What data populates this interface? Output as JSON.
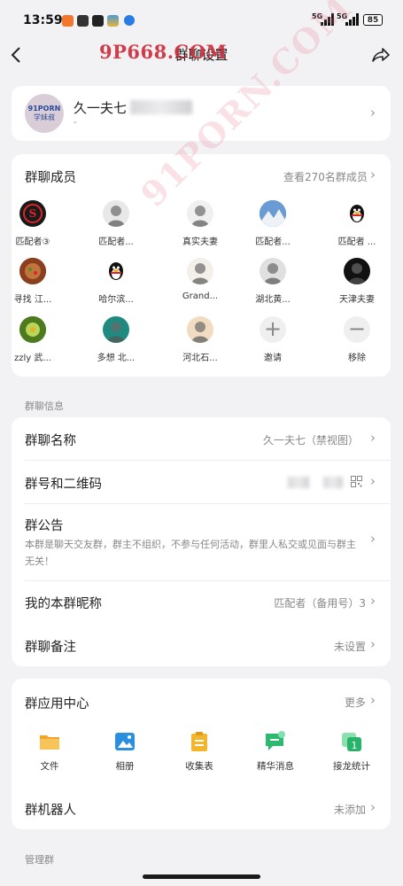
{
  "status": {
    "time": "13:59",
    "net1": "5G",
    "net2": "5G",
    "battery": "85"
  },
  "nav": {
    "title": "群聊设置",
    "watermark": "9P668.COM"
  },
  "diag_watermark": "91PORN.COM",
  "group": {
    "name": "久一夫七",
    "sub": "-",
    "avatar_text1": "91PORN",
    "avatar_text2": "学妹叔"
  },
  "members": {
    "title": "群聊成员",
    "view_all": "查看270名群成员",
    "rows": [
      [
        {
          "name": "匹配者③",
          "color": "#1a1a1a",
          "icon": "S"
        },
        {
          "name": "匹配者...",
          "color": "#e8e8e8",
          "icon": "person"
        },
        {
          "name": "真实夫妻",
          "color": "#f0f0f0",
          "icon": "person"
        },
        {
          "name": "匹配者...",
          "color": "#4a78b0",
          "icon": "mountain"
        },
        {
          "name": "匹配者 ...",
          "color": "#ffffff",
          "icon": "penguin"
        }
      ],
      [
        {
          "name": "寻找 江...",
          "color": "#b0663a",
          "icon": "food"
        },
        {
          "name": "哈尔滨...",
          "color": "#ffffff",
          "icon": "penguin"
        },
        {
          "name": "Grand...",
          "color": "#f3f0ea",
          "icon": "person"
        },
        {
          "name": "湖北黄...",
          "color": "#e0e0e0",
          "icon": "person"
        },
        {
          "name": "天津夫妻",
          "color": "#111111",
          "icon": "person"
        }
      ],
      [
        {
          "name": "zzly 武...",
          "color": "#6a9a2a",
          "icon": "leaf"
        },
        {
          "name": "多想 北...",
          "color": "#1f8a80",
          "icon": "person"
        },
        {
          "name": "河北石...",
          "color": "#f1dcc2",
          "icon": "person"
        },
        {
          "name": "邀请",
          "color": "#efefef",
          "icon": "plus"
        },
        {
          "name": "移除",
          "color": "#efefef",
          "icon": "minus"
        }
      ]
    ]
  },
  "info_section": "群聊信息",
  "info": {
    "group_name_label": "群聊名称",
    "group_name_value": "久一夫七（禁视图）",
    "qr_label": "群号和二维码",
    "notice_label": "群公告",
    "notice_text": "本群是聊天交友群，群主不组织，不参与任何活动，群里人私交或见面与群主无关！",
    "nick_label": "我的本群昵称",
    "nick_value": "匹配者（备用号）3",
    "remark_label": "群聊备注",
    "remark_value": "未设置"
  },
  "apps": {
    "title": "群应用中心",
    "more": "更多",
    "items": [
      {
        "label": "文件",
        "color": "#f4a32a",
        "icon": "folder"
      },
      {
        "label": "相册",
        "color": "#2b8fe0",
        "icon": "photo"
      },
      {
        "label": "收集表",
        "color": "#f2b52b",
        "icon": "clipboard"
      },
      {
        "label": "精华消息",
        "color": "#2dba70",
        "icon": "chat"
      },
      {
        "label": "接龙统计",
        "color": "#27b36a",
        "icon": "chain"
      }
    ],
    "robot_label": "群机器人",
    "robot_value": "未添加"
  },
  "admin_section": "管理群"
}
